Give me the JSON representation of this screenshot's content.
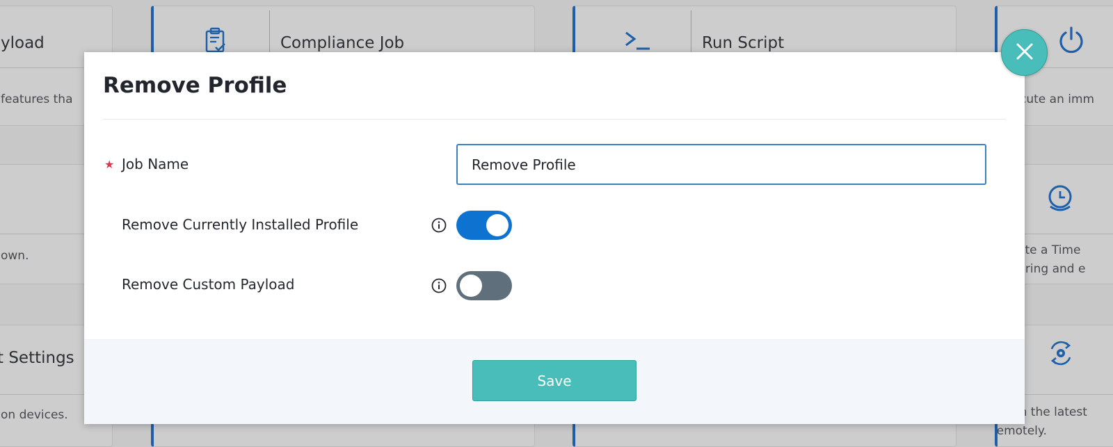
{
  "background": {
    "cards": [
      {
        "title": "yload",
        "desc": "features tha"
      },
      {
        "title": "Compliance Job",
        "desc": ""
      },
      {
        "title": "Run Script",
        "desc": ""
      },
      {
        "title": "",
        "desc": "xecute an imm"
      },
      {
        "title": "",
        "desc": "own."
      },
      {
        "title": "",
        "desc_line1": "reate a Time",
        "desc_line2": "ntering and e"
      },
      {
        "title": "t Settings",
        "desc": "on devices."
      },
      {
        "title": "",
        "desc_line1": "ush the latest",
        "desc_line2": "remotely."
      }
    ],
    "icons": {
      "compliance": "clipboard-check-icon",
      "script": "terminal-prompt-icon",
      "power": "power-icon",
      "timer": "timer-icon",
      "sync_settings": "sync-gear-icon"
    }
  },
  "modal": {
    "title": "Remove Profile",
    "fields": {
      "job_name": {
        "label": "Job Name",
        "value": "Remove Profile",
        "required": true
      },
      "remove_installed": {
        "label": "Remove Currently Installed Profile",
        "enabled": true
      },
      "remove_custom": {
        "label": "Remove Custom Payload",
        "enabled": false
      }
    },
    "save_label": "Save",
    "close_icon": "close-icon"
  },
  "colors": {
    "accent_blue": "#0e73d0",
    "teal": "#48bdb9",
    "toggle_off": "#5f6f7c",
    "required_star": "#e0344a"
  }
}
